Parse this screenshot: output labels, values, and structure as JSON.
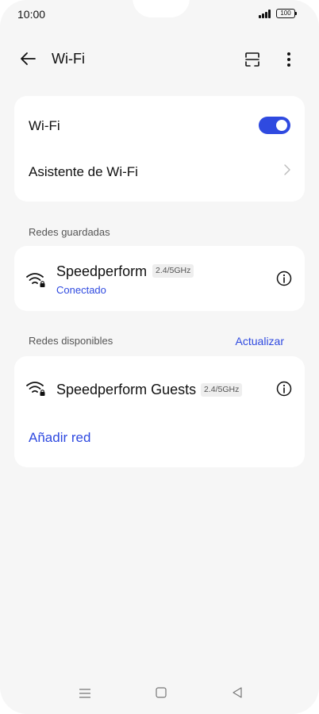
{
  "status_bar": {
    "time": "10:00",
    "battery": "100",
    "icons": [
      "signal-icon",
      "battery-icon"
    ]
  },
  "header": {
    "title": "Wi-Fi",
    "icons": [
      "back-arrow-icon",
      "qr-scan-icon",
      "more-vert-icon"
    ]
  },
  "wifi_card": {
    "toggle_label": "Wi-Fi",
    "toggle_on": true,
    "assistant_label": "Asistente de Wi-Fi"
  },
  "saved_networks": {
    "section_label": "Redes guardadas",
    "items": [
      {
        "ssid": "Speedperform",
        "band": "2.4/5GHz",
        "status": "Conectado"
      }
    ]
  },
  "available_networks": {
    "section_label": "Redes disponibles",
    "refresh_label": "Actualizar",
    "items": [
      {
        "ssid": "Speedperform Guests",
        "band": "2.4/5GHz"
      }
    ],
    "add_network_label": "Añadir red"
  },
  "nav_bar": {
    "icons": [
      "menu-icon",
      "home-icon",
      "back-icon"
    ]
  },
  "colors": {
    "accent": "#2f4ae0",
    "background": "#f6f6f6",
    "card": "#ffffff"
  }
}
